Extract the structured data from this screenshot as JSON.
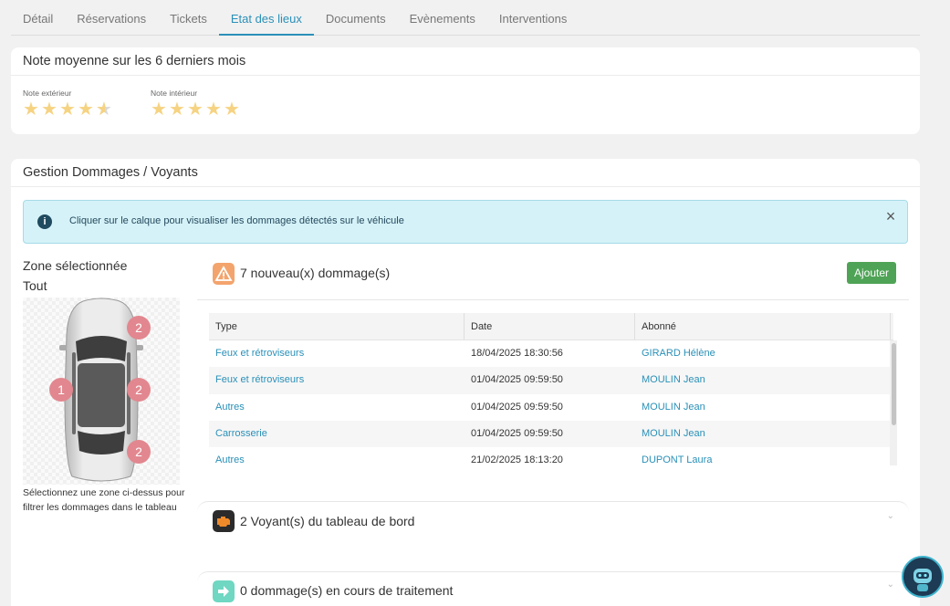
{
  "tabs": [
    {
      "label": "Détail"
    },
    {
      "label": "Réservations"
    },
    {
      "label": "Tickets"
    },
    {
      "label": "Etat des lieux",
      "active": true
    },
    {
      "label": "Documents"
    },
    {
      "label": "Evènements"
    },
    {
      "label": "Interventions"
    }
  ],
  "notes": {
    "title": "Note moyenne sur les 6 derniers mois",
    "exterior": {
      "label": "Note extérieur",
      "rating": 4.5,
      "max": 5
    },
    "interior": {
      "label": "Note intérieur",
      "rating": 5,
      "max": 5
    }
  },
  "damages": {
    "title": "Gestion Dommages / Voyants",
    "alert": {
      "icon": "info-icon",
      "text": "Cliquer sur le calque pour visualiser les dommages détectés sur le véhicule",
      "close": "×"
    },
    "zone": {
      "title": "Zone sélectionnée",
      "value": "Tout",
      "help": "Sélectionnez une zone ci-dessus pour filtrer les dommages dans le tableau",
      "badges": [
        "2",
        "1",
        "2",
        "2"
      ]
    },
    "new_section": {
      "icon": "warning-icon",
      "title": "7 nouveau(x) dommage(s)",
      "add_label": "Ajouter"
    },
    "table": {
      "headers": [
        "Type",
        "Date",
        "Abonné"
      ],
      "rows": [
        {
          "type": "Feux et rétroviseurs",
          "date": "18/04/2025 18:30:56",
          "subscriber": "GIRARD Hélène"
        },
        {
          "type": "Feux et rétroviseurs",
          "date": "01/04/2025 09:59:50",
          "subscriber": "MOULIN Jean"
        },
        {
          "type": "Autres",
          "date": "01/04/2025 09:59:50",
          "subscriber": "MOULIN Jean"
        },
        {
          "type": "Carrosserie",
          "date": "01/04/2025 09:59:50",
          "subscriber": "MOULIN Jean"
        },
        {
          "type": "Autres",
          "date": "21/02/2025 18:13:20",
          "subscriber": "DUPONT Laura"
        }
      ]
    },
    "dashboard_section": {
      "icon": "engine-warning-icon",
      "title": "2 Voyant(s) du tableau de bord",
      "chevron": "⌄"
    },
    "processing_section": {
      "icon": "arrow-right-icon",
      "title": "0 dommage(s) en cours de traitement",
      "chevron": "⌄"
    }
  },
  "colors": {
    "accent": "#2a90b8",
    "add_button": "#4fa356",
    "badge": "#e2878f",
    "star": "#f6d382",
    "alert_bg": "#d5f2f8"
  },
  "assistant": {
    "icon": "robot-assistant-icon"
  }
}
